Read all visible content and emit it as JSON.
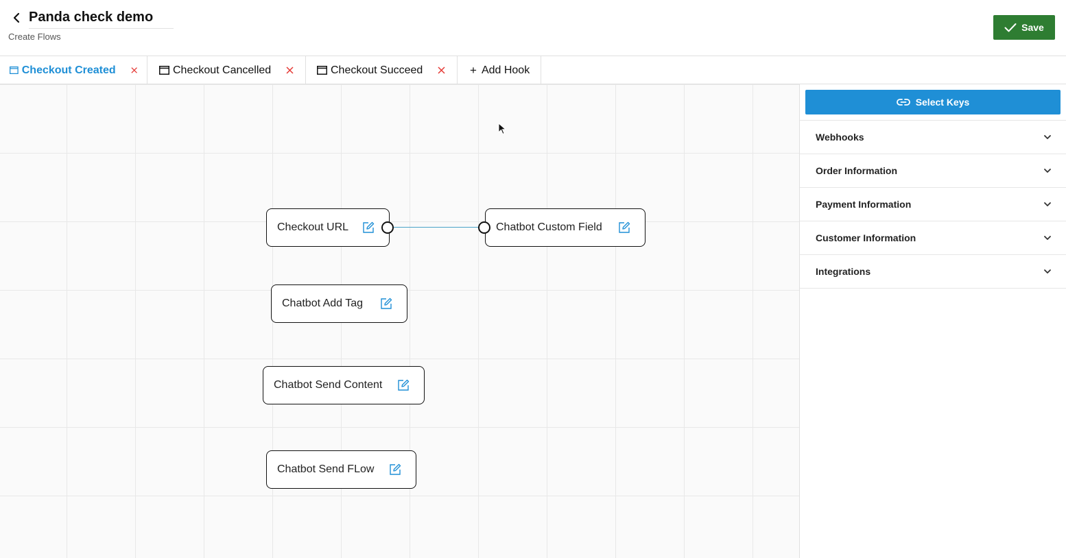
{
  "header": {
    "title": "Panda check demo",
    "subtitle": "Create Flows",
    "save_label": "Save"
  },
  "tabs": [
    {
      "label": "Checkout Created",
      "active": true
    },
    {
      "label": "Checkout Cancelled",
      "active": false
    },
    {
      "label": "Checkout Succeed",
      "active": false
    }
  ],
  "add_hook_label": "Add Hook",
  "nodes": {
    "checkout_url": "Checkout URL",
    "chatbot_custom_field": "Chatbot Custom Field",
    "chatbot_add_tag": "Chatbot Add Tag",
    "chatbot_send_content": "Chatbot Send Content",
    "chatbot_send_flow": "Chatbot Send FLow"
  },
  "sidebar": {
    "select_keys_label": "Select Keys",
    "sections": [
      "Webhooks",
      "Order Information",
      "Payment Information",
      "Customer Information",
      "Integrations"
    ]
  },
  "colors": {
    "accent": "#1f8fd6",
    "save": "#2e7d32",
    "close": "#e53935",
    "connector": "#4aa3c8"
  },
  "icons": {
    "back": "chevron-left-icon",
    "tab": "window-icon",
    "close": "close-icon",
    "edit": "edit-icon",
    "link": "link-icon",
    "expand": "chevron-down-icon"
  }
}
